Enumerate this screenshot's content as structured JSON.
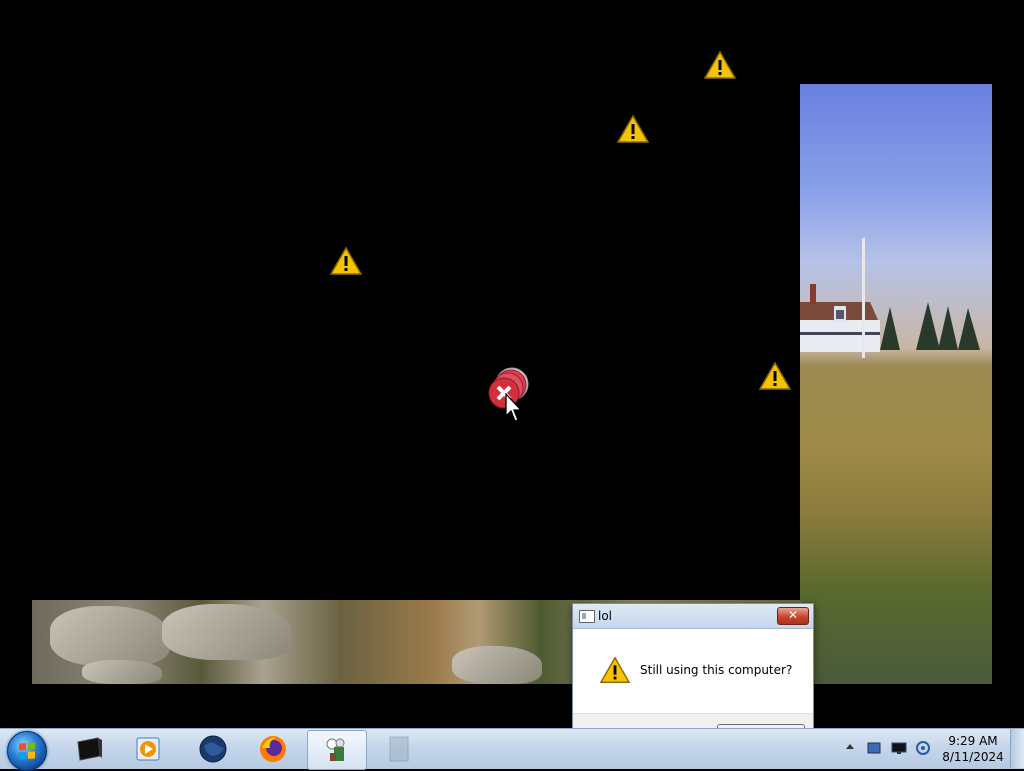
{
  "desktop": {
    "warning_icon": "warning-triangle-icon",
    "error_icon": "error-circle-icon"
  },
  "dialog": {
    "title": "lol",
    "close_label": "✕",
    "message": "Still using this computer?",
    "icon": "warning-triangle-icon"
  },
  "taskbar": {
    "start_icon": "windows-start-orb",
    "pinned": [
      {
        "name": "terminal",
        "icon": "terminal-icon"
      },
      {
        "name": "media-player",
        "icon": "media-player-icon"
      },
      {
        "name": "globe",
        "icon": "globe-icon"
      },
      {
        "name": "firefox",
        "icon": "firefox-icon"
      },
      {
        "name": "running-app",
        "icon": "app-icon",
        "active": true
      },
      {
        "name": "blank-app",
        "icon": "window-icon"
      }
    ],
    "clock": {
      "time": "9:29 AM",
      "date": "8/11/2024"
    }
  },
  "colors": {
    "desktop_background": "#000000",
    "taskbar": "#c5d6ea",
    "warning_yellow": "#f5c400",
    "error_red": "#d0303c"
  }
}
